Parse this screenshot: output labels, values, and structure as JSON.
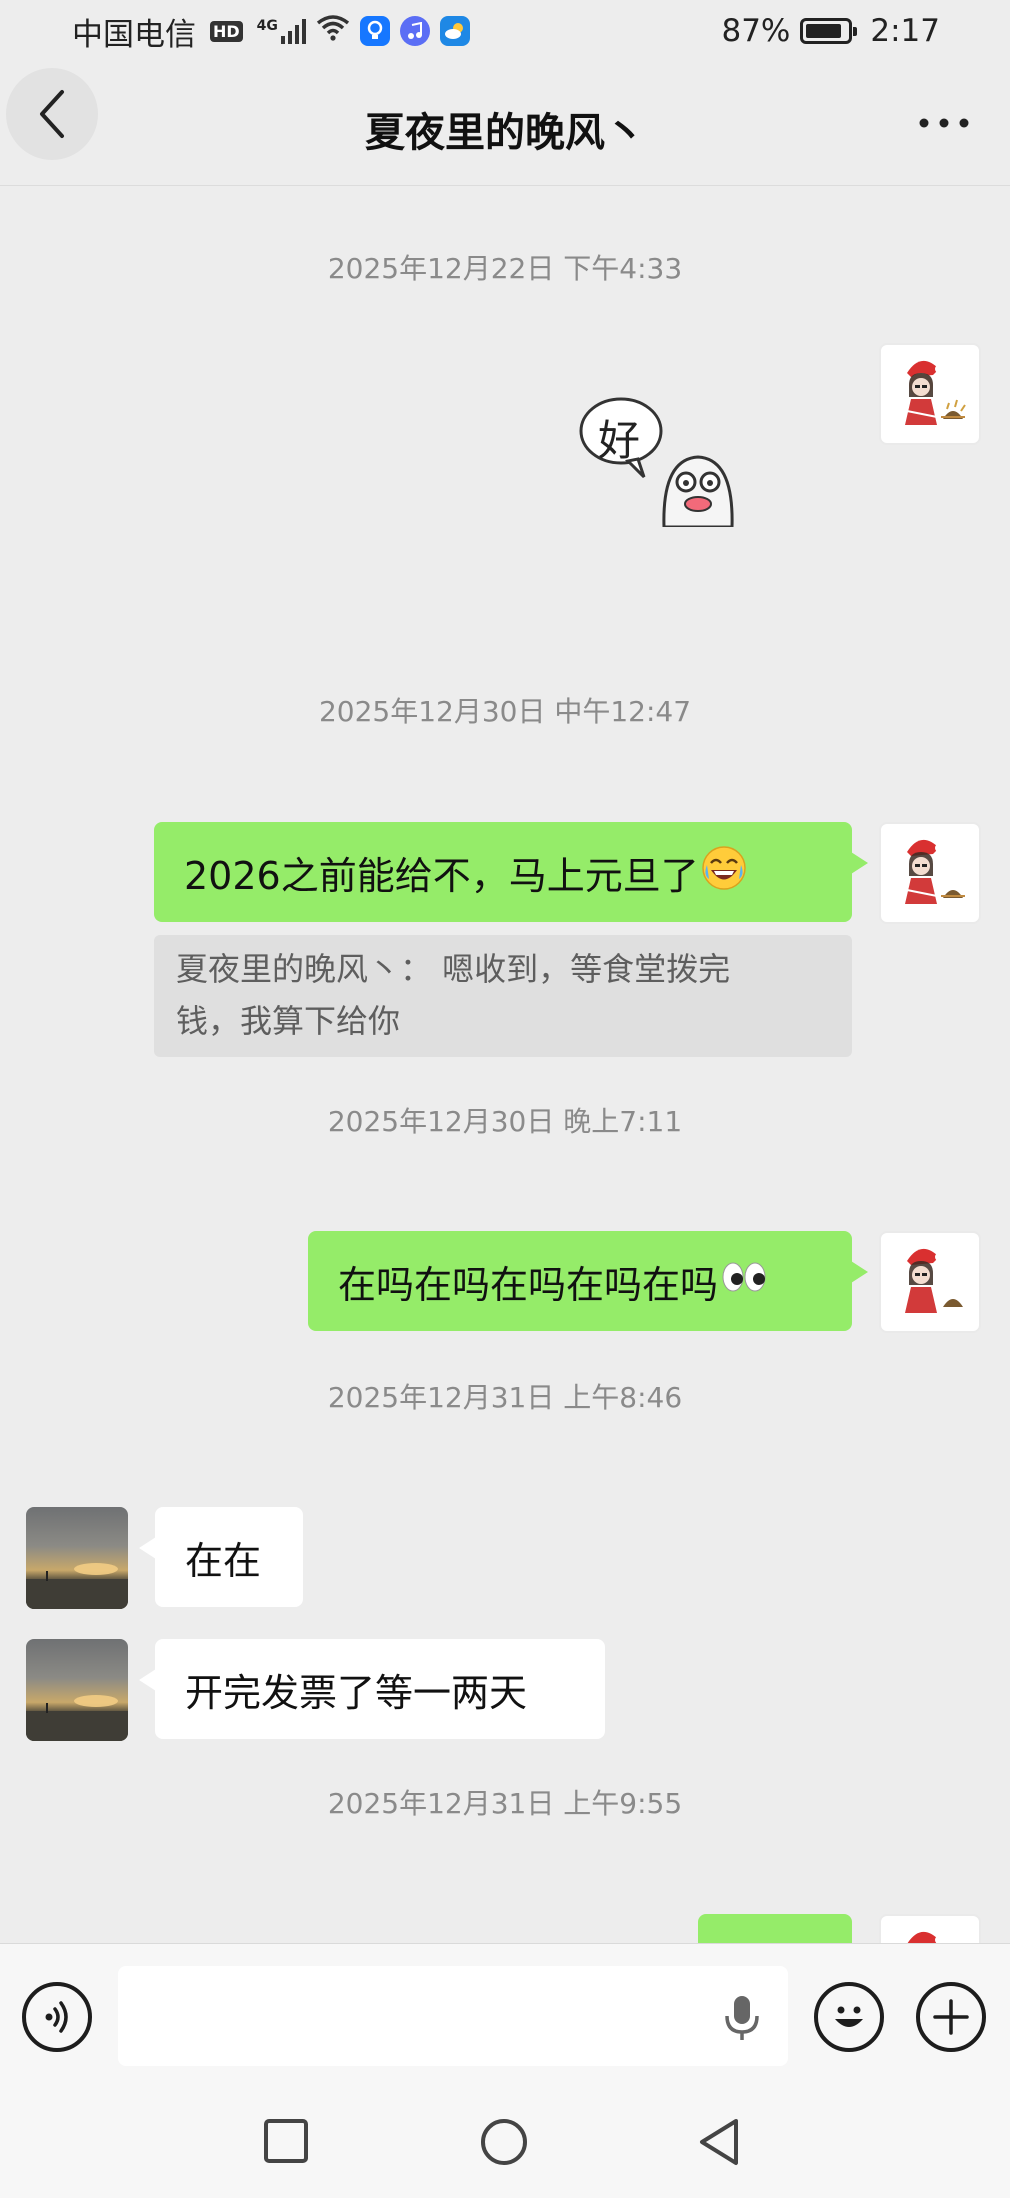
{
  "status_bar": {
    "carrier": "中国电信",
    "hd_badge": "HD",
    "network": "4G",
    "battery_percent": "87%",
    "battery_level": 0.87,
    "time": "2:17"
  },
  "header": {
    "title": "夏夜里的晚风丶"
  },
  "sticker": {
    "text": "好"
  },
  "messages": {
    "ts1": "2025年12月22日 下午4:33",
    "ts2": "2025年12月30日 中午12:47",
    "msg1": "2026之前能给不，马上元旦了",
    "quote_line1": "夏夜里的晚风丶：  嗯收到，等食堂拨完",
    "quote_line2": "钱，我算下给你",
    "ts3": "2025年12月30日 晚上7:11",
    "msg2": "在吗在吗在吗在吗在吗",
    "ts4": "2025年12月31日 上午8:46",
    "msg3": "在在",
    "msg4": "开完发票了等一两天",
    "ts5": "2025年12月31日 上午9:55"
  },
  "input": {
    "placeholder": ""
  },
  "colors": {
    "self_bubble": "#95ec69",
    "other_bubble": "#ffffff",
    "background": "#ededed"
  },
  "icons": [
    "back-icon",
    "more-icon",
    "voice-icon",
    "mic-icon",
    "emoji-icon",
    "plus-icon",
    "recent-apps-icon",
    "home-icon",
    "back-nav-icon"
  ]
}
